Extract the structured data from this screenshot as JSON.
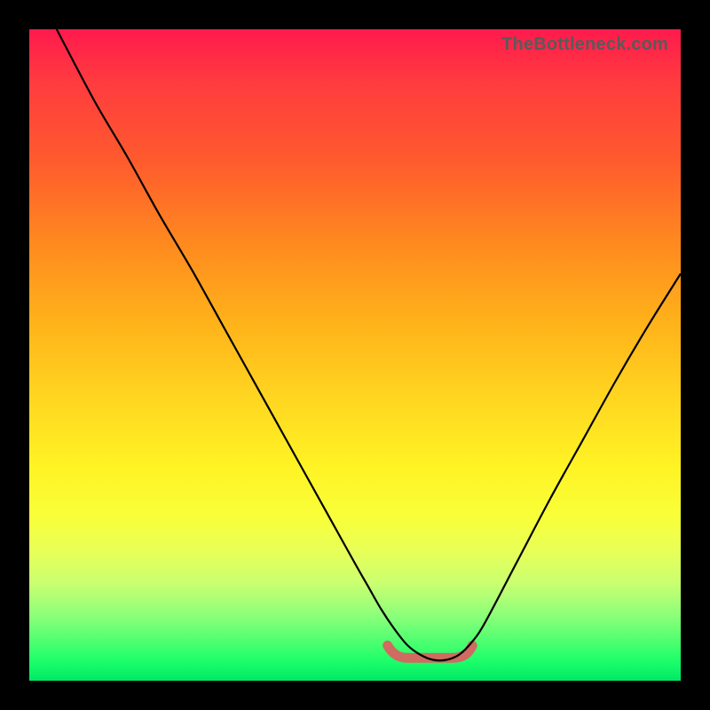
{
  "watermark": "TheBottleneck.com",
  "colors": {
    "frame": "#000000",
    "curve": "#000000",
    "floor_blob": "#cf6b60",
    "gradient_top": "#ff1a4d",
    "gradient_bottom": "#00e865"
  },
  "chart_data": {
    "type": "line",
    "title": "",
    "xlabel": "",
    "ylabel": "",
    "xlim": [
      0,
      100
    ],
    "ylim": [
      0,
      100
    ],
    "grid": false,
    "legend": false,
    "note": "Axes are un-ticked and unlabeled in the image. x/y are nominal 0–100; y read with top=100, bottom=0. Values estimated from pixel positions.",
    "series": [
      {
        "name": "bottleneck-curve",
        "x": [
          4.2,
          10,
          15,
          20,
          25,
          30,
          35,
          40,
          45,
          50,
          52,
          54,
          56,
          58,
          60,
          62,
          64,
          66,
          68,
          70,
          75,
          80,
          85,
          90,
          95,
          100
        ],
        "y": [
          100,
          89,
          80.5,
          71.5,
          63,
          54,
          45,
          36,
          27,
          18,
          14.5,
          11,
          8,
          5.5,
          4,
          3.2,
          3.2,
          4,
          6,
          9,
          18.5,
          28,
          37,
          46,
          54.5,
          62.5
        ]
      }
    ],
    "annotations": [
      {
        "name": "low-span-highlight",
        "kind": "x-range",
        "x_start": 55,
        "x_end": 68,
        "y_approx": 3.5
      }
    ]
  }
}
